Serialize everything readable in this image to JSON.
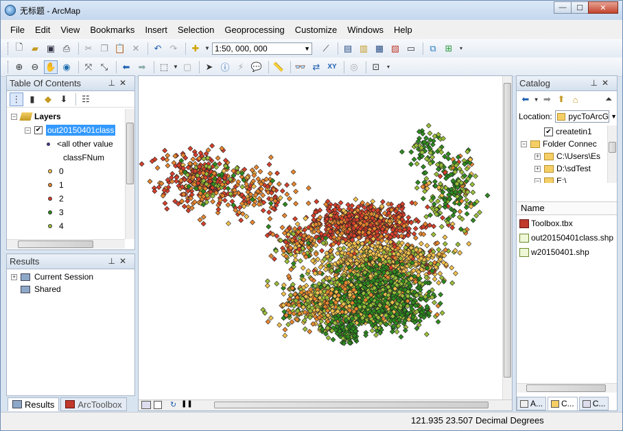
{
  "window": {
    "title": "无标题 - ArcMap",
    "controls": [
      "—",
      "☐",
      "✕"
    ]
  },
  "menu": [
    "File",
    "Edit",
    "View",
    "Bookmarks",
    "Insert",
    "Selection",
    "Geoprocessing",
    "Customize",
    "Windows",
    "Help"
  ],
  "toolbar": {
    "scale": "1:50, 000, 000"
  },
  "toc": {
    "title": "Table Of Contents",
    "root": "Layers",
    "layer": "out20150401class",
    "legend_other": "<all other value",
    "legend_field": "classFNum",
    "classes": [
      {
        "label": "0",
        "color": "#f2c14e"
      },
      {
        "label": "1",
        "color": "#e8872f"
      },
      {
        "label": "2",
        "color": "#d6402b"
      },
      {
        "label": "3",
        "color": "#2e8b1f"
      },
      {
        "label": "4",
        "color": "#9bbf3a"
      }
    ]
  },
  "results": {
    "title": "Results",
    "items": [
      "Current Session",
      "Shared"
    ]
  },
  "bottom_tabs": [
    "Results",
    "ArcToolbox"
  ],
  "catalog": {
    "title": "Catalog",
    "location_label": "Location:",
    "location_value": "pycToArcG",
    "tree": [
      "createtin1",
      "Folder Connec",
      "C:\\Users\\Es",
      "D:\\sdTest",
      "E:\\"
    ],
    "list_header": "Name",
    "files": [
      "Toolbox.tbx",
      "out20150401class.shp",
      "w20150401.shp"
    ],
    "tabs": [
      "A...",
      "C...",
      "C..."
    ]
  },
  "status": {
    "coords": "121.935  23.507 Decimal Degrees"
  }
}
